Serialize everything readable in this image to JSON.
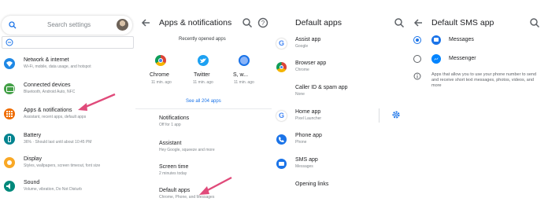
{
  "colors": {
    "accent": "#1a73e8",
    "annotation_arrow": "#e04a7a",
    "network": "#1e88e5",
    "connected": "#43a047",
    "apps": "#ef6c00",
    "battery": "#00838f",
    "display": "#f9a825",
    "sound": "#00897b",
    "text_secondary": "#80868b"
  },
  "settings": {
    "search_placeholder": "Search settings",
    "items": [
      {
        "title": "Network & internet",
        "subtitle": "Wi-Fi, mobile, data usage, and hotspot",
        "icon": "wifi-icon"
      },
      {
        "title": "Connected devices",
        "subtitle": "Bluetooth, Android Auto, NFC",
        "icon": "devices-icon"
      },
      {
        "title": "Apps & notifications",
        "subtitle": "Assistant, recent apps, default apps",
        "icon": "apps-grid-icon"
      },
      {
        "title": "Battery",
        "subtitle": "36% · Should last until about 10:45 PM",
        "icon": "battery-icon"
      },
      {
        "title": "Display",
        "subtitle": "Styles, wallpapers, screen timeout, font size",
        "icon": "brightness-icon"
      },
      {
        "title": "Sound",
        "subtitle": "Volume, vibration, Do Not Disturb",
        "icon": "volume-icon"
      }
    ]
  },
  "apps_notifications": {
    "title": "Apps & notifications",
    "recent_label": "Recently opened apps",
    "recent_apps": [
      {
        "name": "Chrome",
        "time": "11 min. ago",
        "icon": "chrome-icon"
      },
      {
        "name": "Twitter",
        "time": "11 min. ago",
        "icon": "twitter-icon"
      },
      {
        "name": "S, w...",
        "time": "11 min. ago",
        "icon": "app-icon"
      }
    ],
    "see_all": "See all 204 apps",
    "items": [
      {
        "title": "Notifications",
        "subtitle": "Off for 1 app"
      },
      {
        "title": "Assistant",
        "subtitle": "Hey Google, squeeze and more"
      },
      {
        "title": "Screen time",
        "subtitle": "2 minutes today"
      },
      {
        "title": "Default apps",
        "subtitle": "Chrome, Phone, and Messages"
      }
    ]
  },
  "default_apps": {
    "title": "Default apps",
    "items": [
      {
        "title": "Assist app",
        "subtitle": "Google",
        "icon": "google-icon"
      },
      {
        "title": "Browser app",
        "subtitle": "Chrome",
        "icon": "chrome-icon"
      },
      {
        "title": "Caller ID & spam app",
        "subtitle": "None",
        "icon": ""
      },
      {
        "title": "Home app",
        "subtitle": "Pixel Launcher",
        "icon": "google-icon"
      },
      {
        "title": "Phone app",
        "subtitle": "Phone",
        "icon": "phone-icon"
      },
      {
        "title": "SMS app",
        "subtitle": "Messages",
        "icon": "messages-icon"
      },
      {
        "title": "Opening links",
        "subtitle": "",
        "icon": ""
      }
    ]
  },
  "sms": {
    "title": "Default SMS app",
    "options": [
      {
        "name": "Messages",
        "selected": true,
        "icon": "messages-icon"
      },
      {
        "name": "Messenger",
        "selected": false,
        "icon": "messenger-icon"
      }
    ],
    "info": "Apps that allow you to use your phone number to send and receive short text messages, photos, videos, and more"
  }
}
